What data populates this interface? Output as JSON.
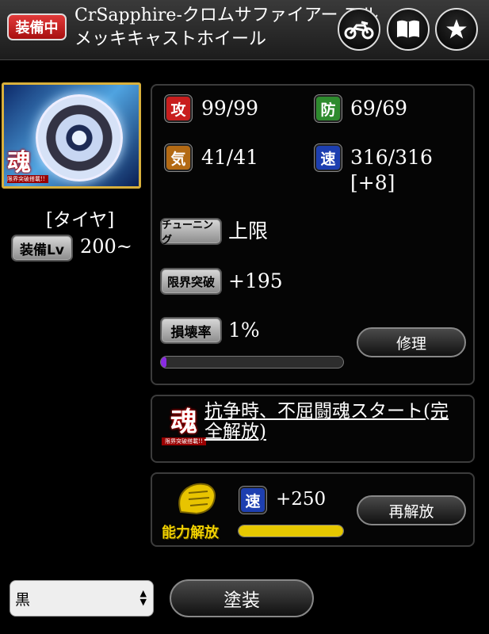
{
  "header": {
    "equip_badge": "装備中",
    "title_line1": "CrSapphire-クロムサファイアー フル",
    "title_line2": "メッキキャストホイール",
    "buttons": [
      {
        "icon": "motorcycle-icon"
      },
      {
        "icon": "book-icon"
      },
      {
        "icon": "star-icon"
      }
    ]
  },
  "part": {
    "thumbnail_icon": "chrome-wheel-image",
    "soul_badge": "魂",
    "soul_badge_sub": "限界突破搭載!!",
    "type_label": "[タイヤ]",
    "equip_lv_label": "装備Lv",
    "equip_lv_value": "200~"
  },
  "stats": {
    "attack": {
      "icon_label": "攻",
      "value": "99/99",
      "color": "#c81e1e"
    },
    "defense": {
      "icon_label": "防",
      "value": "69/69",
      "color": "#2e8b2e"
    },
    "ki": {
      "icon_label": "気",
      "value": "41/41",
      "color": "#b36a14"
    },
    "speed": {
      "icon_label": "速",
      "value": "316/316",
      "bonus": "[+8]",
      "color": "#1d3fb0"
    },
    "tuning_label": "チューニング",
    "tuning_value": "上限",
    "limit_break_label": "限界突破",
    "limit_break_value": "+195",
    "damage_label": "損壊率",
    "damage_value": "1%",
    "damage_ratio": 0.01,
    "repair_button": "修理"
  },
  "skill": {
    "text": "抗争時、不屈闘魂スタート(完全解放)"
  },
  "ability": {
    "badge_text": "能力解放",
    "stat_icon_label": "速",
    "stat_value": "+250",
    "progress": 1.0,
    "progress_color": "#e6c800",
    "rerelease_button": "再解放"
  },
  "footer": {
    "color_select_value": "黒",
    "paint_button": "塗装"
  }
}
